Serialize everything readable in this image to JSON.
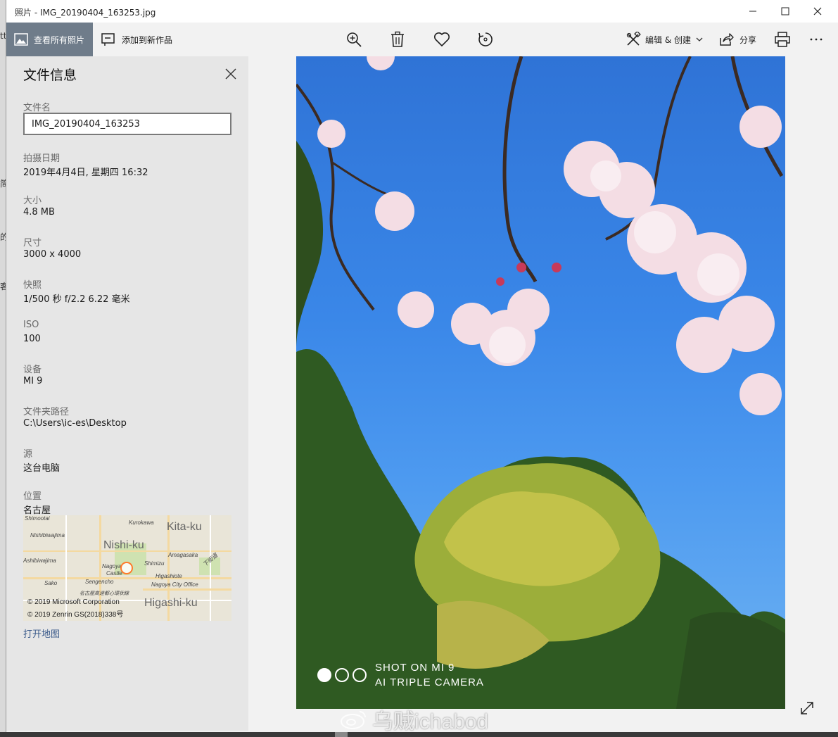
{
  "window": {
    "title": "照片 - IMG_20190404_163253.jpg"
  },
  "toolbar": {
    "view_all_label": "查看所有照片",
    "add_to_creation_label": "添加到新作品",
    "edit_create_label": "编辑 & 创建",
    "share_label": "分享"
  },
  "info_panel": {
    "title": "文件信息",
    "filename_label": "文件名",
    "filename_value": "IMG_20190404_163253",
    "fields": [
      {
        "label": "拍摄日期",
        "value": "2019年4月4日, 星期四 16:32"
      },
      {
        "label": "大小",
        "value": "4.8 MB"
      },
      {
        "label": "尺寸",
        "value": "3000 x 4000"
      },
      {
        "label": "快照",
        "value": "1/500 秒 f/2.2 6.22 毫米"
      },
      {
        "label": "ISO",
        "value": "100"
      },
      {
        "label": "设备",
        "value": "MI 9"
      },
      {
        "label": "文件夹路径",
        "value": "C:\\Users\\ic-es\\Desktop"
      },
      {
        "label": "源",
        "value": "这台电脑"
      },
      {
        "label": "位置",
        "value": "名古屋"
      }
    ],
    "map": {
      "labels": {
        "shimootai": "Shimootai",
        "kurokawa": "Kurokawa",
        "kita_ku": "Kita-ku",
        "nishibiwajima": "Nishibiwajima",
        "nishi_ku": "Nishi-ku",
        "amagasaka": "Amagasaka",
        "shinkawa": "Ashibiwajima",
        "nagoya": "Nagoya",
        "castle": "Castle",
        "shimizu": "Shimizu",
        "sako": "Sako",
        "sengencho": "Sengencho",
        "higashiote": "Higashiote",
        "city_office": "Nagoya City Office",
        "shimodo": "下街道",
        "higashi_ku": "Higashi-ku",
        "meitetsu": "名古屋高速都心環状線",
        "copyright_ms": "© 2019 Microsoft Corporation",
        "copyright_zenrin": "© 2019 Zenrin GS(2018)338号"
      }
    },
    "open_map_label": "打开地图"
  },
  "photo": {
    "overlay_line1": "SHOT ON MI 9",
    "overlay_line2": "AI TRIPLE CAMERA",
    "watermark": "乌贼ichabod"
  },
  "background_window": {
    "fragments": [
      "tt",
      "简",
      "的",
      "客"
    ]
  },
  "colors": {
    "view_all_bg": "#6f7c8a",
    "panel_bg": "#e6e6e6",
    "toolbar_bg": "#f2f2f2",
    "link": "#3a5a8a",
    "map_pin": "#ff7a2a"
  }
}
